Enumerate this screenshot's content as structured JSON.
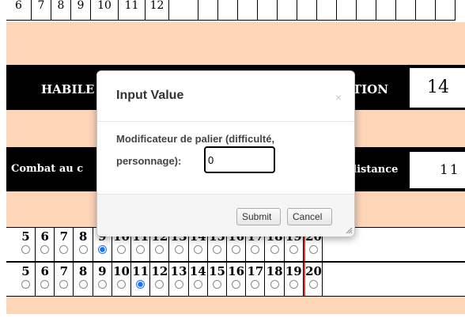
{
  "top_row": {
    "numbers": [
      "6",
      "7",
      "8",
      "9",
      "10",
      "11",
      "12",
      "",
      "",
      "",
      "",
      "",
      "",
      "",
      "",
      "",
      "",
      "",
      "",
      "",
      ""
    ]
  },
  "habilete": {
    "label": "HABILE",
    "right_label": "TION",
    "value": "14"
  },
  "combat": {
    "label": "Combat au c",
    "right_label": "distance",
    "value": "11"
  },
  "grid1": {
    "numbers": [
      "5",
      "6",
      "7",
      "8",
      "9",
      "10",
      "11",
      "12",
      "13",
      "14",
      "15",
      "16",
      "17",
      "18",
      "19",
      "20"
    ],
    "selected": "9"
  },
  "grid2": {
    "numbers": [
      "5",
      "6",
      "7",
      "8",
      "9",
      "10",
      "11",
      "12",
      "13",
      "14",
      "15",
      "16",
      "17",
      "18",
      "19",
      "20"
    ],
    "selected": "11"
  },
  "dialog": {
    "title": "Input Value",
    "close_glyph": "×",
    "prompt_line1": "Modificateur de palier (difficulté,",
    "prompt_line2": "personnage):",
    "input_value": "0",
    "submit_label": "Submit",
    "cancel_label": "Cancel"
  },
  "colors": {
    "peach": "#fdd6b8",
    "accent": "#1a73e8",
    "red_border": "#e53935"
  }
}
